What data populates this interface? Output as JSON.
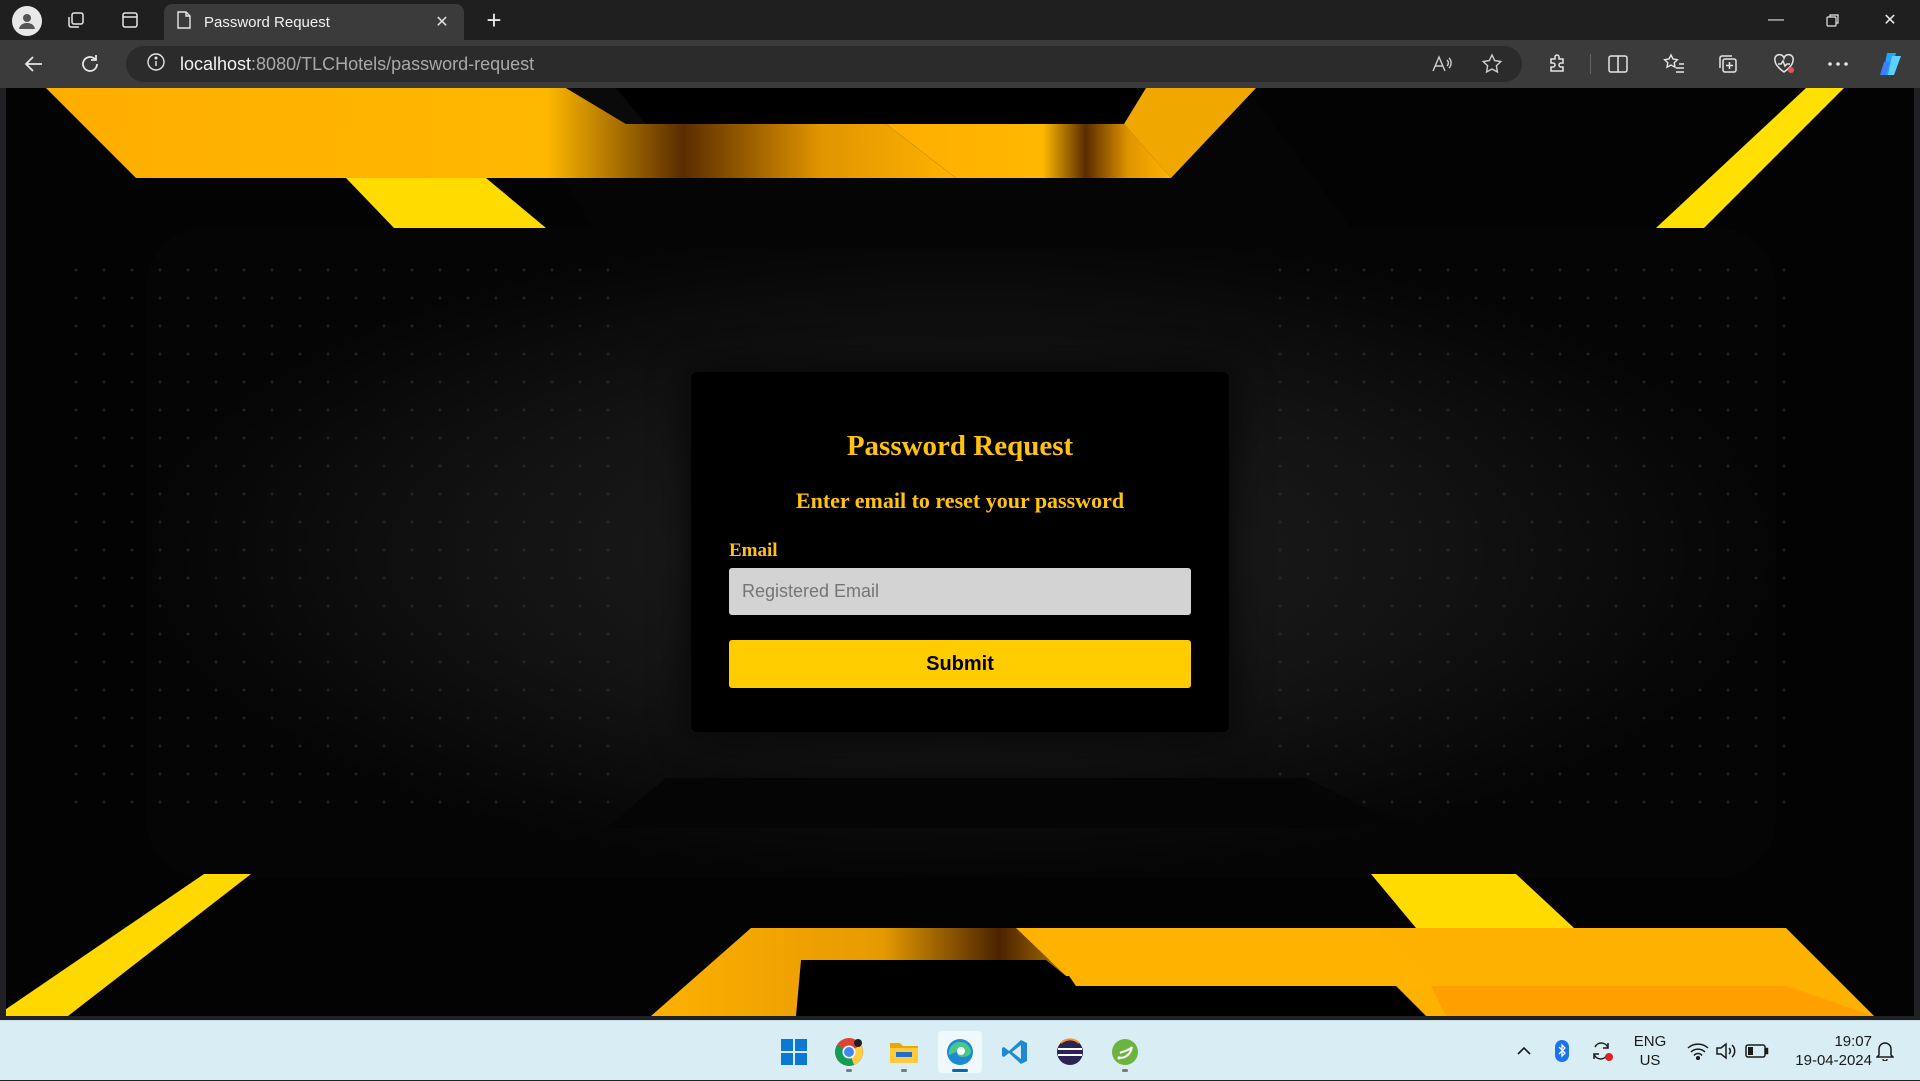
{
  "browser": {
    "tab_title": "Password Request",
    "url_host": "localhost",
    "url_path": ":8080/TLCHotels/password-request"
  },
  "form": {
    "title": "Password Request",
    "subtitle": "Enter email to reset your password",
    "email_label": "Email",
    "email_placeholder": "Registered Email",
    "submit_label": "Submit"
  },
  "colors": {
    "accent_gold": "#ffc20e",
    "button_yellow": "#ffcc00",
    "background": "#000000"
  },
  "taskbar": {
    "apps": [
      "windows-start",
      "chrome",
      "file-explorer",
      "edge",
      "vscode",
      "eclipse",
      "spring-tools"
    ],
    "lang_line1": "ENG",
    "lang_line2": "US",
    "time": "19:07",
    "date": "19-04-2024"
  }
}
